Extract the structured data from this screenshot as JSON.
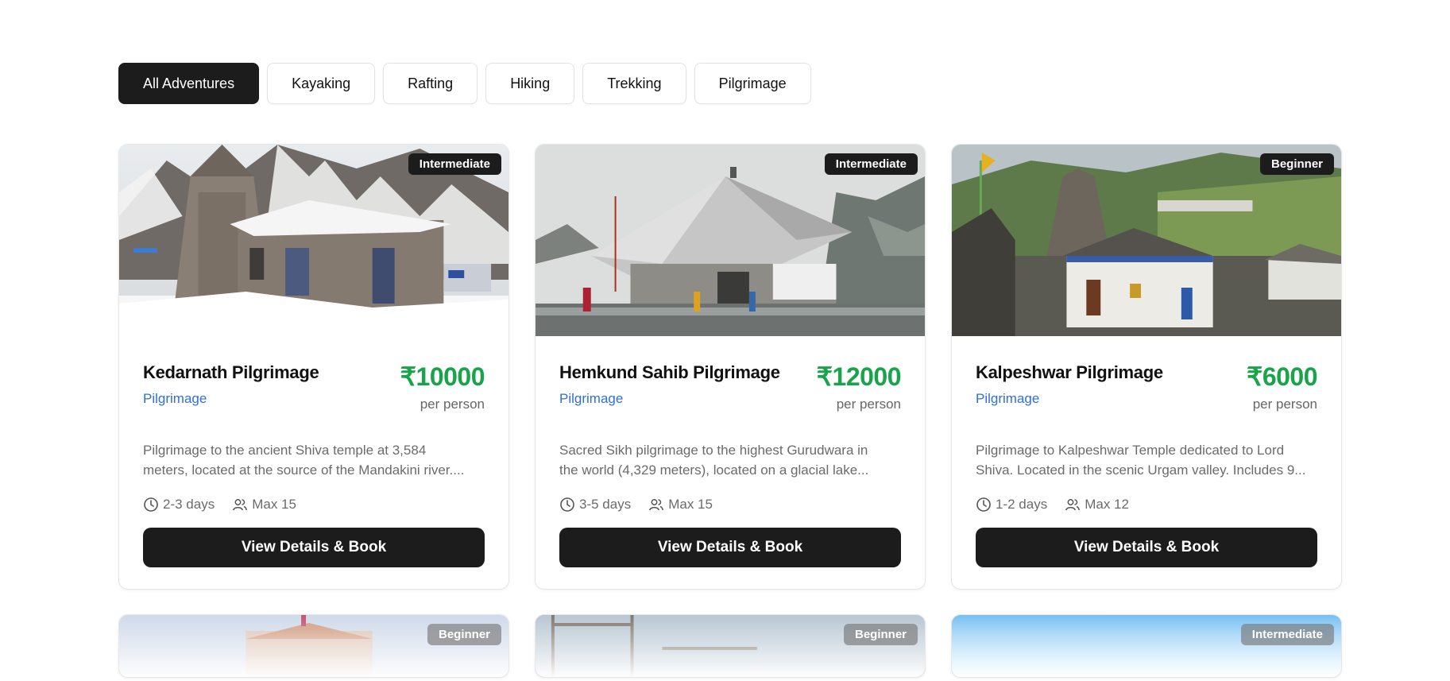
{
  "filters": [
    {
      "label": "All Adventures",
      "active": true
    },
    {
      "label": "Kayaking",
      "active": false
    },
    {
      "label": "Rafting",
      "active": false
    },
    {
      "label": "Hiking",
      "active": false
    },
    {
      "label": "Trekking",
      "active": false
    },
    {
      "label": "Pilgrimage",
      "active": false
    }
  ],
  "cards": [
    {
      "badge": "Intermediate",
      "title": "Kedarnath Pilgrimage",
      "category": "Pilgrimage",
      "price": "₹10000",
      "price_unit": "per person",
      "desc_line1": "Pilgrimage to the ancient Shiva temple at 3,584",
      "desc_line2": "meters, located at the source of the Mandakini river....",
      "duration": "2-3 days",
      "group": "Max 15",
      "button": "View Details & Book"
    },
    {
      "badge": "Intermediate",
      "title": "Hemkund Sahib Pilgrimage",
      "category": "Pilgrimage",
      "price": "₹12000",
      "price_unit": "per person",
      "desc_line1": "Sacred Sikh pilgrimage to the highest Gurudwara in",
      "desc_line2": "the world (4,329 meters), located on a glacial lake...",
      "duration": "3-5 days",
      "group": "Max 15",
      "button": "View Details & Book"
    },
    {
      "badge": "Beginner",
      "title": "Kalpeshwar Pilgrimage",
      "category": "Pilgrimage",
      "price": "₹6000",
      "price_unit": "per person",
      "desc_line1": "Pilgrimage to Kalpeshwar Temple dedicated to Lord",
      "desc_line2": "Shiva. Located in the scenic Urgam valley. Includes 9...",
      "duration": "1-2 days",
      "group": "Max 12",
      "button": "View Details & Book"
    }
  ],
  "next_row_badges": [
    "Beginner",
    "Beginner",
    "Intermediate"
  ],
  "colors": {
    "accent_dark": "#1c1c1c",
    "price_green": "#19a34a",
    "category_blue": "#2f6fd6"
  },
  "icons": {
    "duration": "clock-icon",
    "group": "users-icon"
  }
}
